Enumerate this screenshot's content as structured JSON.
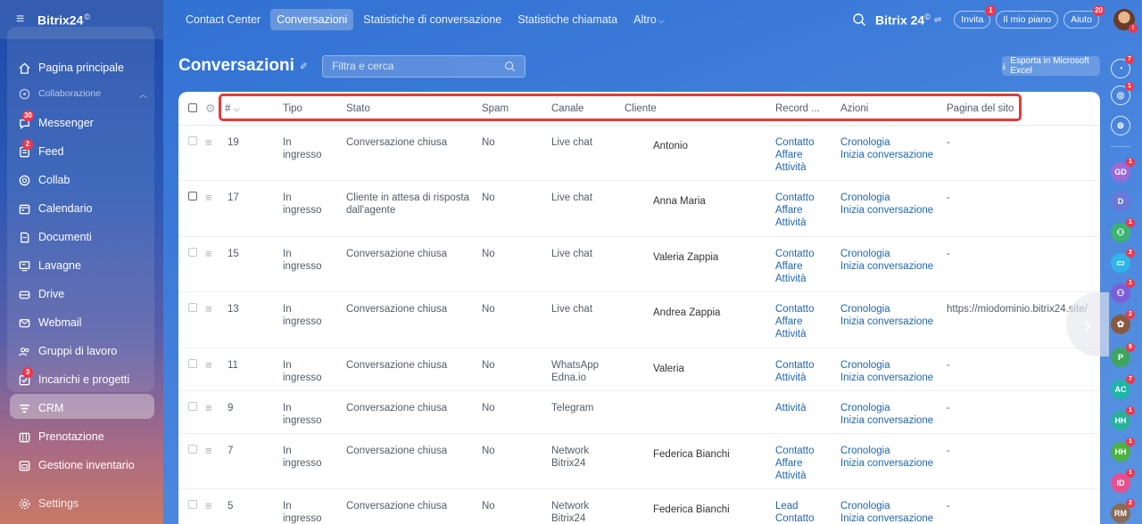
{
  "sidebar": {
    "logo": "Bitrix24",
    "logo_sup": "©",
    "items": [
      {
        "label": "Pagina principale",
        "icon": "home-icon"
      },
      {
        "label": "Collaborazione",
        "icon": "collab-section-icon"
      },
      {
        "label": "Messenger",
        "icon": "messenger-icon",
        "badge": "30"
      },
      {
        "label": "Feed",
        "icon": "feed-icon",
        "badge": "2"
      },
      {
        "label": "Collab",
        "icon": "collab-icon"
      },
      {
        "label": "Calendario",
        "icon": "calendar-icon"
      },
      {
        "label": "Documenti",
        "icon": "documents-icon"
      },
      {
        "label": "Lavagne",
        "icon": "boards-icon"
      },
      {
        "label": "Drive",
        "icon": "drive-icon"
      },
      {
        "label": "Webmail",
        "icon": "mail-icon"
      },
      {
        "label": "Gruppi di lavoro",
        "icon": "groups-icon"
      },
      {
        "label": "Incarichi e progetti",
        "icon": "tasks-icon",
        "badge": "3"
      },
      {
        "label": "CRM",
        "icon": "crm-icon"
      },
      {
        "label": "Prenotazione",
        "icon": "booking-icon"
      },
      {
        "label": "Gestione inventario",
        "icon": "inventory-icon"
      },
      {
        "label": "Settings",
        "icon": "settings-icon"
      }
    ]
  },
  "topbar": {
    "nav": [
      {
        "label": "Contact Center"
      },
      {
        "label": "Conversazioni"
      },
      {
        "label": "Statistiche di conversazione"
      },
      {
        "label": "Statistiche chiamata"
      },
      {
        "label": "Altro"
      }
    ],
    "logo": "Bitrix 24",
    "logo_sup": "©",
    "invite_label": "Invita",
    "invite_badge": "1",
    "plan_label": "Il mio piano",
    "help_label": "Aiuto",
    "help_badge": "20",
    "avatar_badge": "!"
  },
  "page": {
    "title": "Conversazioni",
    "filter_placeholder": "Filtra e cerca",
    "export_label": "Esporta in Microsoft Excel"
  },
  "table": {
    "headers": {
      "num": "#",
      "tipo": "Tipo",
      "stato": "Stato",
      "spam": "Spam",
      "canale": "Canale",
      "cliente": "Cliente",
      "record": "Record ...",
      "azioni": "Azioni",
      "pagina": "Pagina del sito"
    },
    "rows": [
      {
        "num": "19",
        "tipo": "In ingresso",
        "stato": "Conversazione chiusa",
        "spam": "No",
        "canale": "Live chat",
        "cliente": "Antonio",
        "record": [
          "Contatto",
          "Affare",
          "Attività"
        ],
        "azioni": [
          "Cronologia",
          "Inizia conversazione"
        ],
        "pagina": "-"
      },
      {
        "num": "17",
        "tipo": "In ingresso",
        "stato": "Cliente in attesa di risposta dall'agente",
        "spam": "No",
        "canale": "Live chat",
        "cliente": "Anna Maria",
        "record": [
          "Contatto",
          "Affare",
          "Attività"
        ],
        "azioni": [
          "Cronologia",
          "Inizia conversazione"
        ],
        "pagina": "-"
      },
      {
        "num": "15",
        "tipo": "In ingresso",
        "stato": "Conversazione chiusa",
        "spam": "No",
        "canale": "Live chat",
        "cliente": "Valeria Zappia",
        "record": [
          "Contatto",
          "Affare",
          "Attività"
        ],
        "azioni": [
          "Cronologia",
          "Inizia conversazione"
        ],
        "pagina": "-"
      },
      {
        "num": "13",
        "tipo": "In ingresso",
        "stato": "Conversazione chiusa",
        "spam": "No",
        "canale": "Live chat",
        "cliente": "Andrea Zappia",
        "record": [
          "Contatto",
          "Affare",
          "Attività"
        ],
        "azioni": [
          "Cronologia",
          "Inizia conversazione"
        ],
        "pagina": "https://miodominio.bitrix24.site/"
      },
      {
        "num": "11",
        "tipo": "In ingresso",
        "stato": "Conversazione chiusa",
        "spam": "No",
        "canale": "WhatsApp Edna.io",
        "cliente": "Valeria",
        "record": [
          "Contatto",
          "Attività"
        ],
        "azioni": [
          "Cronologia",
          "Inizia conversazione"
        ],
        "pagina": "-"
      },
      {
        "num": "9",
        "tipo": "In ingresso",
        "stato": "Conversazione chiusa",
        "spam": "No",
        "canale": "Telegram",
        "cliente": "",
        "record": [
          "Attività"
        ],
        "azioni": [
          "Cronologia",
          "Inizia conversazione"
        ],
        "pagina": "-"
      },
      {
        "num": "7",
        "tipo": "In ingresso",
        "stato": "Conversazione chiusa",
        "spam": "No",
        "canale": "Network Bitrix24",
        "cliente": "Federica Bianchi",
        "record": [
          "Contatto",
          "Affare",
          "Attività"
        ],
        "azioni": [
          "Cronologia",
          "Inizia conversazione"
        ],
        "pagina": "-"
      },
      {
        "num": "5",
        "tipo": "In ingresso",
        "stato": "Conversazione chiusa",
        "spam": "No",
        "canale": "Network Bitrix24",
        "cliente": "Federica Bianchi",
        "record": [
          "Lead",
          "Contatto"
        ],
        "azioni": [
          "Cronologia",
          "Inizia conversazione"
        ],
        "pagina": "-"
      }
    ]
  },
  "rail": [
    {
      "type": "bell-icon",
      "badge": "7"
    },
    {
      "type": "copilot-icon",
      "badge": "1"
    },
    {
      "type": "chat-search-icon",
      "badge": ""
    },
    {
      "type": "avatar",
      "initials": "GD",
      "color": "#9b6bd6",
      "badge": "1"
    },
    {
      "type": "avatar",
      "initials": "D",
      "color": "#6a78d8",
      "badge": ""
    },
    {
      "type": "avatar",
      "initials": "",
      "color": "#3cb371",
      "badge": "1",
      "icon": "group-chat-icon"
    },
    {
      "type": "avatar",
      "initials": "",
      "color": "#2fb5e8",
      "badge": "2",
      "icon": "chat-icon"
    },
    {
      "type": "avatar",
      "initials": "",
      "color": "#7b5fd6",
      "badge": "1",
      "icon": "group-chat-icon"
    },
    {
      "type": "avatar",
      "initials": "",
      "color": "#8a5a40",
      "badge": "2",
      "icon": "photo-icon"
    },
    {
      "type": "avatar",
      "initials": "P",
      "color": "#3da55f",
      "badge": "9"
    },
    {
      "type": "avatar",
      "initials": "AC",
      "color": "#20b5a8",
      "badge": "7"
    },
    {
      "type": "avatar",
      "initials": "HH",
      "color": "#29b19a",
      "badge": "1"
    },
    {
      "type": "avatar",
      "initials": "HH",
      "color": "#4bb143",
      "badge": "1"
    },
    {
      "type": "avatar",
      "initials": "ID",
      "color": "#e94f8e",
      "badge": "1"
    },
    {
      "type": "avatar",
      "initials": "RM",
      "color": "#8a6b55",
      "badge": "2"
    }
  ]
}
